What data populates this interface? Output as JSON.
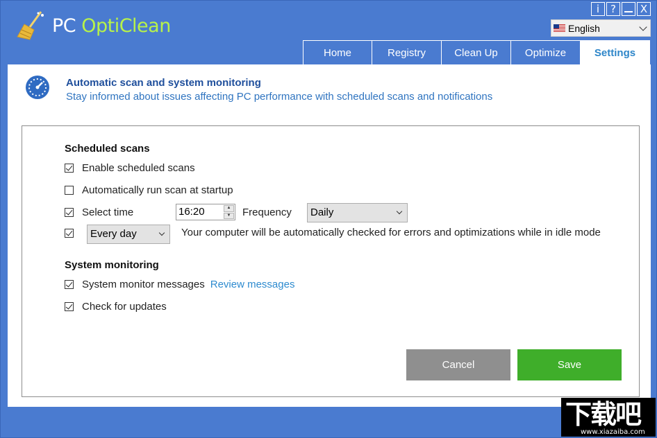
{
  "app": {
    "title_part1": "PC ",
    "title_part2": "OptiClean",
    "logo_icon": "broom-icon"
  },
  "window_buttons": [
    "i",
    "?",
    "—",
    "X"
  ],
  "language": {
    "selected": "English",
    "flag_icon": "us-flag-icon"
  },
  "tabs": [
    {
      "label": "Home"
    },
    {
      "label": "Registry"
    },
    {
      "label": "Clean Up"
    },
    {
      "label": "Optimize"
    },
    {
      "label": "Settings",
      "active": true
    }
  ],
  "header": {
    "icon": "gauge-icon",
    "title": "Automatic scan and system monitoring",
    "subtitle": "Stay informed about issues affecting PC performance with scheduled scans and notifications"
  },
  "scheduled": {
    "title": "Scheduled scans",
    "enable_label": "Enable scheduled scans",
    "enable_checked": true,
    "startup_label": "Automatically run scan at startup",
    "startup_checked": false,
    "select_time_label": "Select time",
    "select_time_checked": true,
    "time_value": "16:20",
    "frequency_label": "Frequency",
    "frequency_value": "Daily",
    "day_checked": true,
    "day_value": "Every day",
    "idle_note": "Your computer will be automatically checked for errors and optimizations while in idle mode"
  },
  "monitoring": {
    "title": "System monitoring",
    "messages_label": "System monitor messages",
    "messages_checked": true,
    "review_link": "Review messages",
    "updates_label": "Check for updates",
    "updates_checked": true
  },
  "buttons": {
    "cancel": "Cancel",
    "save": "Save"
  },
  "colors": {
    "frame_blue": "#4a7bd0",
    "accent": "#2e86c9",
    "save_green": "#3fae2a",
    "cancel_gray": "#8f8f8f"
  },
  "watermark": {
    "main": "下载吧",
    "url": "www.xiazaiba.com"
  }
}
